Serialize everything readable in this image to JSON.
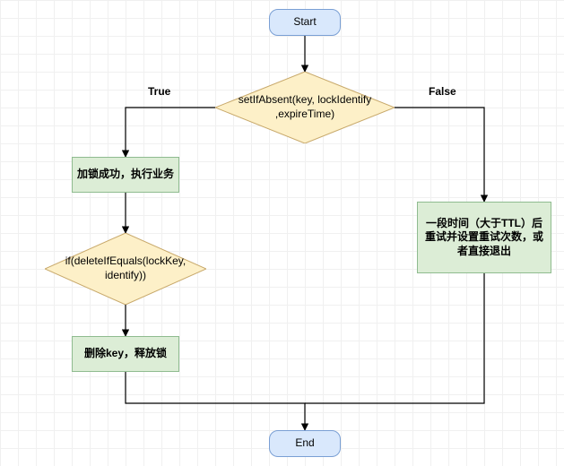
{
  "chart_data": {
    "type": "flowchart",
    "nodes": [
      {
        "id": "start",
        "kind": "terminator",
        "label": "Start"
      },
      {
        "id": "d1",
        "kind": "decision",
        "label": "setIfAbsent(key, lockIdentify ,expireTime)"
      },
      {
        "id": "p1",
        "kind": "process",
        "label": "加锁成功，执行业务"
      },
      {
        "id": "d2",
        "kind": "decision",
        "label": "if(deleteIfEquals(lockKey, identify))"
      },
      {
        "id": "p2",
        "kind": "process",
        "label": "删除key，释放锁"
      },
      {
        "id": "p3",
        "kind": "process",
        "label": "一段时间（大于TTL）后重试并设置重试次数，或者直接退出"
      },
      {
        "id": "end",
        "kind": "terminator",
        "label": "End"
      }
    ],
    "edges": [
      {
        "from": "start",
        "to": "d1",
        "label": ""
      },
      {
        "from": "d1",
        "to": "p1",
        "label": "True"
      },
      {
        "from": "d1",
        "to": "p3",
        "label": "False"
      },
      {
        "from": "p1",
        "to": "d2",
        "label": ""
      },
      {
        "from": "d2",
        "to": "p2",
        "label": ""
      },
      {
        "from": "p2",
        "to": "end",
        "label": ""
      },
      {
        "from": "p3",
        "to": "end",
        "label": ""
      }
    ]
  },
  "labels": {
    "start": "Start",
    "end": "End",
    "decision1": "setIfAbsent(key, lockIdentify ,expireTime)",
    "process1": "加锁成功，执行业务",
    "decision2": "if(deleteIfEquals(lockKey, identify))",
    "process2": "删除key，释放锁",
    "process3": "一段时间（大于TTL）后重试并设置重试次数，或者直接退出",
    "true": "True",
    "false": "False"
  }
}
